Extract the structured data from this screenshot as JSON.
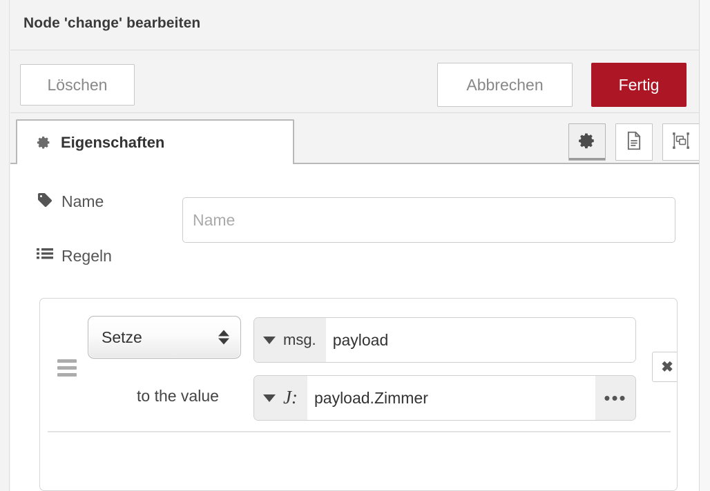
{
  "dialog": {
    "title": "Node 'change' bearbeiten"
  },
  "actions": {
    "delete_label": "Löschen",
    "cancel_label": "Abbrechen",
    "done_label": "Fertig",
    "done_color": "#ad1625"
  },
  "tabs": [
    {
      "label": "Eigenschaften",
      "icon": "gear-icon",
      "active": true
    }
  ],
  "view_buttons": [
    {
      "name": "properties",
      "icon": "gear-icon",
      "active": true
    },
    {
      "name": "description",
      "icon": "document-icon",
      "active": false
    },
    {
      "name": "appearance",
      "icon": "appearance-icon",
      "active": false
    }
  ],
  "form": {
    "name_label": "Name",
    "name_icon": "tag-icon",
    "name_value": "",
    "name_placeholder": "Name",
    "rules_label": "Regeln",
    "rules_icon": "list-icon"
  },
  "rules": [
    {
      "drag_handle": "drag-handle-icon",
      "action": "Setze",
      "target": {
        "type": "msg.",
        "value": "payload"
      },
      "to_label": "to the value",
      "source": {
        "type": "J:",
        "type_name": "jsonata",
        "value": "payload.Zimmer",
        "expand_label": "•••"
      },
      "remove_label": "✖"
    }
  ]
}
